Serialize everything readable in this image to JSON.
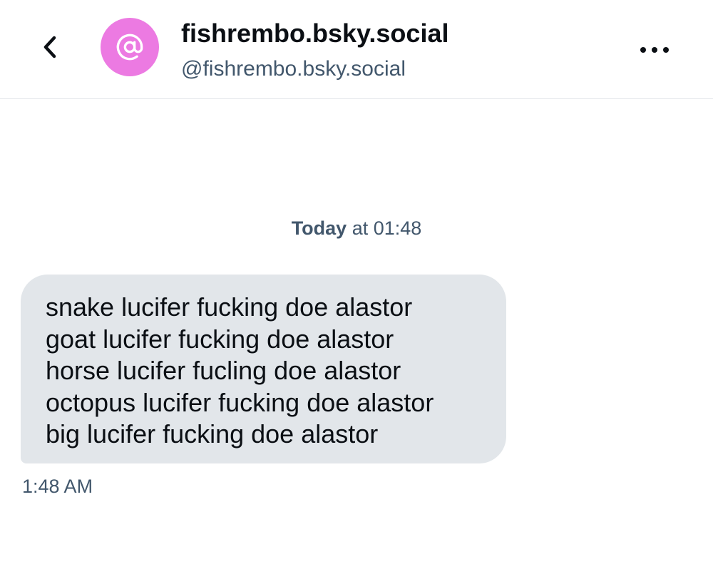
{
  "header": {
    "back_icon": "chevron-left-icon",
    "avatar_icon": "at-sign-icon",
    "avatar_color": "#ec7ae2",
    "display_name": "fishrembo.bsky.social",
    "handle": "@fishrembo.bsky.social",
    "more_icon": "more-horizontal-icon"
  },
  "conversation": {
    "date_separator": {
      "day": "Today",
      "rest": "at 01:48"
    },
    "messages": [
      {
        "lines": [
          "snake lucifer fucking doe alastor",
          "goat lucifer fucking doe alastor",
          "horse lucifer fucling doe alastor",
          "octopus lucifer fucking doe alastor",
          "big lucifer fucking doe alastor"
        ],
        "time": "1:48 AM",
        "bubble_color": "#e2e6ea"
      }
    ]
  }
}
